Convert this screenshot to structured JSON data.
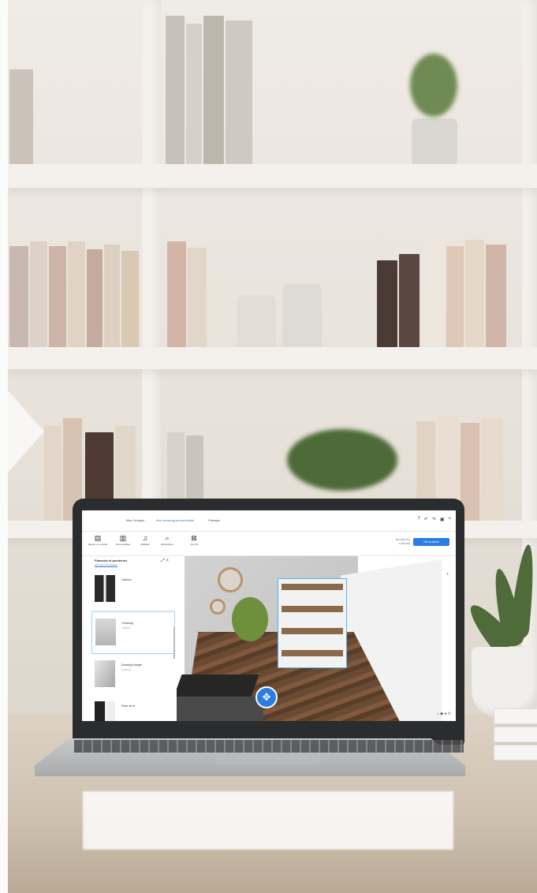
{
  "topbar": {
    "brand": "Mes Designs",
    "project": "Mon dressing personnalisé",
    "share": "Partager"
  },
  "toolbar": {
    "tools": [
      "Ajouter un meuble",
      "Personnaliser",
      "Modèles",
      "Rechercher",
      "Vue 3D"
    ],
    "price_line1": "Prix total TTC",
    "price_line2": "1 250,00 €",
    "cta": "Voir le panier"
  },
  "sidebar": {
    "title": "Placards et penderies",
    "subtitle": "Voir tous nos produits",
    "cards": [
      {
        "name": "Caisson",
        "meta": ""
      },
      {
        "name": "Dressing",
        "meta": "L 80 cm"
      },
      {
        "name": "Dressing d'angle",
        "meta": "L 100 cm"
      },
      {
        "name": "Porte de lit",
        "meta": ""
      }
    ]
  }
}
